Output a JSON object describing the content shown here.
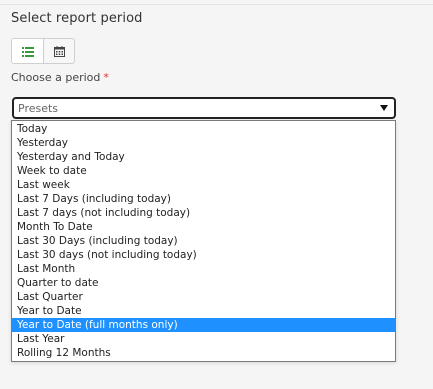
{
  "header": {
    "title": "Select report period"
  },
  "view_toggle": {
    "list_icon": "list-icon",
    "calendar_icon": "calendar-icon",
    "active": "list"
  },
  "period_field": {
    "label": "Choose a period",
    "required_mark": "*",
    "selected_value": "Presets"
  },
  "dropdown": {
    "selected_index": 14,
    "options": [
      "Today",
      "Yesterday",
      "Yesterday and Today",
      "Week to date",
      "Last week",
      "Last 7 Days (including today)",
      "Last 7 days (not including today)",
      "Month To Date",
      "Last 30 Days (including today)",
      "Last 30 days (not including today)",
      "Last Month",
      "Quarter to date",
      "Last Quarter",
      "Year to Date",
      "Year to Date (full months only)",
      "Last Year",
      "Rolling 12 Months"
    ]
  },
  "colors": {
    "highlight": "#1e90ff",
    "accent_green": "#3a9a3a",
    "required_red": "#e0322f"
  }
}
